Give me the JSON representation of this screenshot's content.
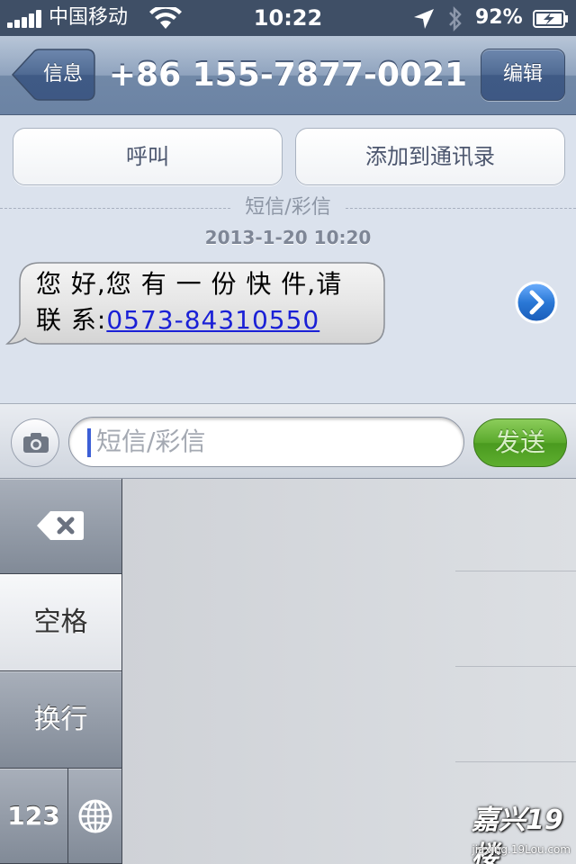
{
  "status_bar": {
    "carrier": "中国移动",
    "time": "10:22",
    "battery_percent": "92%",
    "icons": [
      "signal-icon",
      "wifi-icon",
      "location-arrow-icon",
      "bluetooth-icon",
      "battery-charging-icon"
    ]
  },
  "nav": {
    "back_label": "信息",
    "title": "+86 155-7877-0021",
    "edit_label": "编辑"
  },
  "actions": {
    "call_label": "呼叫",
    "add_contact_label": "添加到通讯录"
  },
  "thread": {
    "divider_label": "短信/彩信",
    "timestamp": "2013-1-20 10:20",
    "message": {
      "line1": "您 好,您 有 一 份 快 件,请",
      "line2_prefix": "联 系:",
      "phone_link": "0573-84310550"
    }
  },
  "composer": {
    "placeholder": "短信/彩信",
    "send_label": "发送"
  },
  "keyboard": {
    "space_label": "空格",
    "return_label": "换行",
    "numbers_label": "123"
  },
  "watermark": {
    "brand": "嘉兴19楼",
    "url": "jiaxing.19Lou.com"
  },
  "colors": {
    "nav_blue": "#6b83a4",
    "link_blue": "#1a20d6",
    "send_green": "#5aa92c",
    "detail_blue": "#2a78d6"
  }
}
